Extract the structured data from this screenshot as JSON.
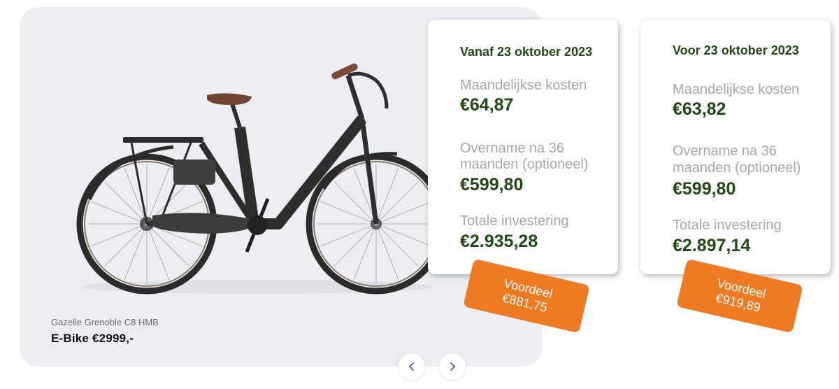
{
  "product": {
    "brand_model": "Gazelle Grenoble C8 HMB",
    "title": "E-Bike €2999,-"
  },
  "carousel": {
    "prev_icon": "chevron-left-icon",
    "next_icon": "chevron-right-icon",
    "accent": "#5b4bd6"
  },
  "offers": [
    {
      "date": "Vanaf 23 oktober 2023",
      "monthly_label": "Maandelijkse kosten",
      "monthly_value": "€64,87",
      "takeover_label_1": "Overname na 36",
      "takeover_label_2": "maanden (optioneel)",
      "takeover_value": "€599,80",
      "total_label": "Totale investering",
      "total_value": "€2.935,28",
      "badge_label": "Voordeel",
      "badge_value": "€881,75"
    },
    {
      "date": "Voor 23 oktober 2023",
      "monthly_label": "Maandelijkse kosten",
      "monthly_value": "€63,82",
      "takeover_label_1": "Overname na 36",
      "takeover_label_2": "maanden (optioneel)",
      "takeover_value": "€599,80",
      "total_label": "Totale investering",
      "total_value": "€2.897,14",
      "badge_label": "Voordeel",
      "badge_value": "€919,89"
    }
  ],
  "colors": {
    "value_green": "#1f4a12",
    "label_gray": "#a8a8a8",
    "badge_orange": "#ee7a21",
    "panel_bg": "#eceef3"
  }
}
